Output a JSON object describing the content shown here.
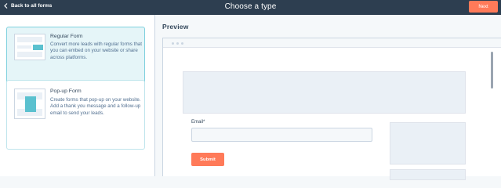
{
  "header": {
    "back_label": "Back to all forms",
    "title": "Choose a type",
    "next_label": "Next"
  },
  "form_types": [
    {
      "name": "Regular Form",
      "description": "Convert more leads with regular forms that you can embed on your website or share across platforms.",
      "selected": true
    },
    {
      "name": "Pop-up Form",
      "description": "Create forms that pop-up on your website. Add a thank you message and a follow-up email to send your leads.",
      "selected": false
    }
  ],
  "preview": {
    "label": "Preview",
    "email_label": "Email*",
    "submit_label": "Submit"
  },
  "colors": {
    "topbar": "#2d3e50",
    "accent": "#ff7a59",
    "selected_bg": "#e5f5f8",
    "teal": "#5bc1cf"
  }
}
